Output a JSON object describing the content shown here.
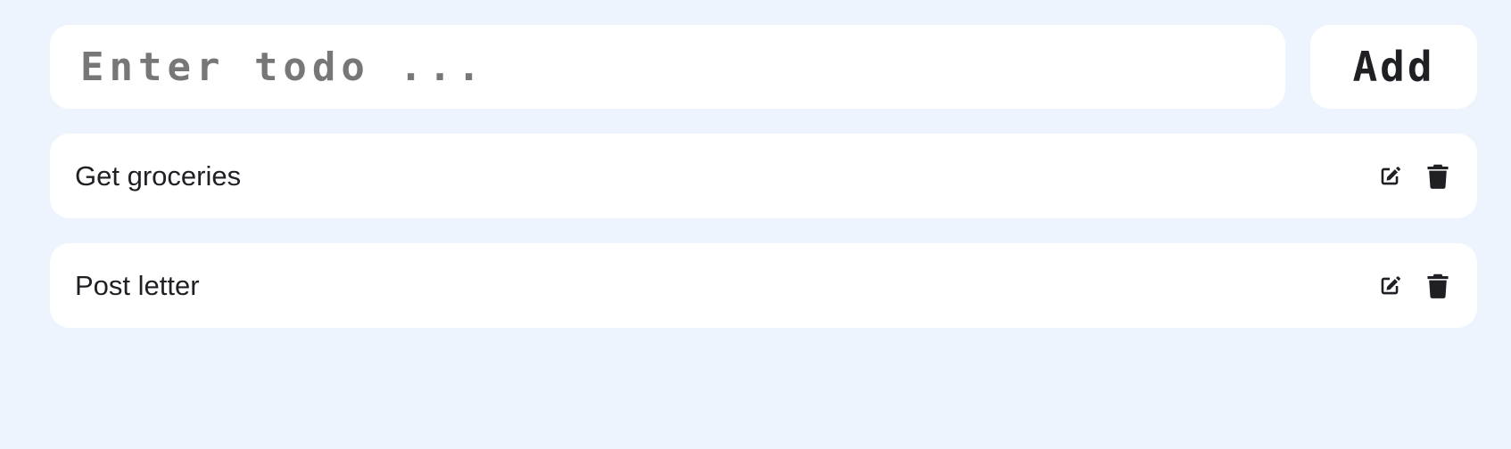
{
  "new_todo": {
    "placeholder": "Enter todo ...",
    "value": "",
    "add_label": "Add"
  },
  "todos": [
    {
      "text": "Get groceries",
      "edit_icon": "edit-icon",
      "delete_icon": "trash-icon"
    },
    {
      "text": "Post letter",
      "edit_icon": "edit-icon",
      "delete_icon": "trash-icon"
    }
  ],
  "colors": {
    "background": "#eef4fd",
    "card": "#ffffff",
    "text": "#1f1f24",
    "placeholder": "#777777"
  }
}
